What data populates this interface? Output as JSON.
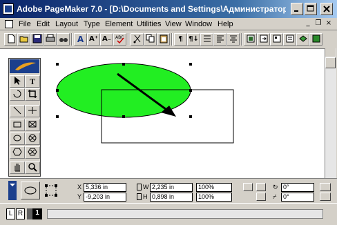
{
  "window": {
    "title": "Adobe PageMaker 7.0 - [D:\\Documents and Settings\\Администратор\\..."
  },
  "menu": {
    "items": [
      "File",
      "Edit",
      "Layout",
      "Type",
      "Element",
      "Utilities",
      "View",
      "Window",
      "Help"
    ],
    "mdi_min": "_",
    "mdi_restore": "❐",
    "mdi_close": "×"
  },
  "toolbar": {
    "buttons": [
      "new",
      "open",
      "save",
      "print",
      "find",
      "A",
      "A⁺",
      "A₋",
      "ABC",
      "cut",
      "copy",
      "paste",
      "¶",
      "¶↓",
      "list",
      "align-left",
      "align-center",
      "frame",
      "export",
      "place",
      "layers"
    ]
  },
  "toolbox": {
    "tools": [
      "pointer",
      "T",
      "rotate",
      "crop",
      "line",
      "constrained-line",
      "rectangle",
      "rectangle-frame",
      "ellipse",
      "ellipse-frame",
      "polygon",
      "polygon-frame",
      "hand",
      "zoom"
    ]
  },
  "control": {
    "x_label": "X",
    "y_label": "Y",
    "w_label": "W",
    "h_label": "H",
    "x_value": "5,336 in",
    "y_value": "-9,203 in",
    "w_value": "2,235 in",
    "h_value": "0,898 in",
    "w_pct": "100%",
    "h_pct": "100%",
    "rot_value": "0°",
    "skew_value": "0°"
  },
  "pages": {
    "left_label": "L",
    "right_label": "R",
    "current_page": "1"
  },
  "colors": {
    "ellipse_fill": "#22ee22",
    "title_start": "#0a246a",
    "title_end": "#a6caf0"
  }
}
